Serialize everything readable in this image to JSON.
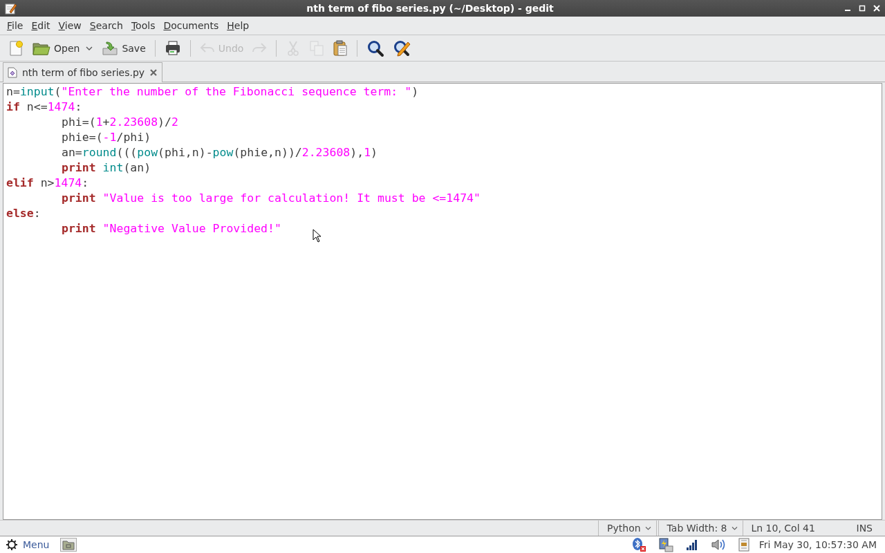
{
  "window": {
    "title": "nth term of fibo series.py (~/Desktop) - gedit"
  },
  "menu": [
    "File",
    "Edit",
    "View",
    "Search",
    "Tools",
    "Documents",
    "Help"
  ],
  "toolbar": [
    {
      "kind": "new",
      "disabled": false
    },
    {
      "kind": "open",
      "label": "Open",
      "disabled": false
    },
    {
      "kind": "dropdown",
      "disabled": false
    },
    {
      "kind": "save",
      "label": "Save",
      "disabled": false
    },
    {
      "kind": "separator"
    },
    {
      "kind": "print",
      "disabled": false
    },
    {
      "kind": "separator"
    },
    {
      "kind": "undo",
      "label": "Undo",
      "disabled": true
    },
    {
      "kind": "redo",
      "disabled": true
    },
    {
      "kind": "separator"
    },
    {
      "kind": "cut",
      "disabled": true
    },
    {
      "kind": "copy",
      "disabled": true
    },
    {
      "kind": "paste",
      "disabled": false
    },
    {
      "kind": "separator"
    },
    {
      "kind": "find",
      "disabled": false
    },
    {
      "kind": "replace",
      "disabled": false
    }
  ],
  "tabs": [
    {
      "label": "nth term of fibo series.py",
      "selected": true
    }
  ],
  "editor": {
    "lines": [
      {
        "indented": false,
        "tokens": [
          {
            "kind": "plain",
            "text": "n="
          },
          {
            "kind": "builtin",
            "text": "input"
          },
          {
            "kind": "plain",
            "text": "("
          },
          {
            "kind": "string",
            "text": "\"Enter the number of the Fibonacci sequence term: \""
          },
          {
            "kind": "plain",
            "text": ")"
          }
        ]
      },
      {
        "indented": false,
        "tokens": [
          {
            "kind": "keyword",
            "text": "if"
          },
          {
            "kind": "plain",
            "text": " n<="
          },
          {
            "kind": "number",
            "text": "1474"
          },
          {
            "kind": "plain",
            "text": ":"
          }
        ]
      },
      {
        "indented": true,
        "tokens": [
          {
            "kind": "plain",
            "text": "phi=("
          },
          {
            "kind": "number",
            "text": "1"
          },
          {
            "kind": "plain",
            "text": "+"
          },
          {
            "kind": "number",
            "text": "2.23608"
          },
          {
            "kind": "plain",
            "text": ")/"
          },
          {
            "kind": "number",
            "text": "2"
          }
        ]
      },
      {
        "indented": true,
        "tokens": [
          {
            "kind": "plain",
            "text": "phie=("
          },
          {
            "kind": "number",
            "text": "-1"
          },
          {
            "kind": "plain",
            "text": "/phi)"
          }
        ]
      },
      {
        "indented": true,
        "tokens": [
          {
            "kind": "plain",
            "text": "an="
          },
          {
            "kind": "builtin",
            "text": "round"
          },
          {
            "kind": "plain",
            "text": "((("
          },
          {
            "kind": "builtin",
            "text": "pow"
          },
          {
            "kind": "plain",
            "text": "(phi,n)-"
          },
          {
            "kind": "builtin",
            "text": "pow"
          },
          {
            "kind": "plain",
            "text": "(phie,n))/"
          },
          {
            "kind": "number",
            "text": "2.23608"
          },
          {
            "kind": "plain",
            "text": "),"
          },
          {
            "kind": "number",
            "text": "1"
          },
          {
            "kind": "plain",
            "text": ")"
          }
        ]
      },
      {
        "indented": true,
        "tokens": [
          {
            "kind": "keyword",
            "text": "print "
          },
          {
            "kind": "builtin",
            "text": "int"
          },
          {
            "kind": "plain",
            "text": "(an)"
          }
        ]
      },
      {
        "indented": false,
        "tokens": [
          {
            "kind": "keyword",
            "text": "elif"
          },
          {
            "kind": "plain",
            "text": " n>"
          },
          {
            "kind": "number",
            "text": "1474"
          },
          {
            "kind": "plain",
            "text": ":"
          }
        ]
      },
      {
        "indented": true,
        "tokens": [
          {
            "kind": "keyword",
            "text": "print "
          },
          {
            "kind": "string",
            "text": "\"Value is too large for calculation! It must be <=1474\""
          }
        ]
      },
      {
        "indented": false,
        "tokens": [
          {
            "kind": "keyword",
            "text": "else"
          },
          {
            "kind": "plain",
            "text": ":"
          }
        ]
      },
      {
        "indented": true,
        "tokens": [
          {
            "kind": "keyword",
            "text": "print "
          },
          {
            "kind": "string",
            "text": "\"Negative Value Provided!\""
          }
        ]
      }
    ]
  },
  "status_bar": {
    "language": "Python",
    "tab_width": "Tab Width: 8",
    "position": "Ln 10, Col 41",
    "mode": "INS"
  },
  "taskbar": {
    "menu": "Menu",
    "clock": "Fri May 30, 10:57:30 AM"
  }
}
